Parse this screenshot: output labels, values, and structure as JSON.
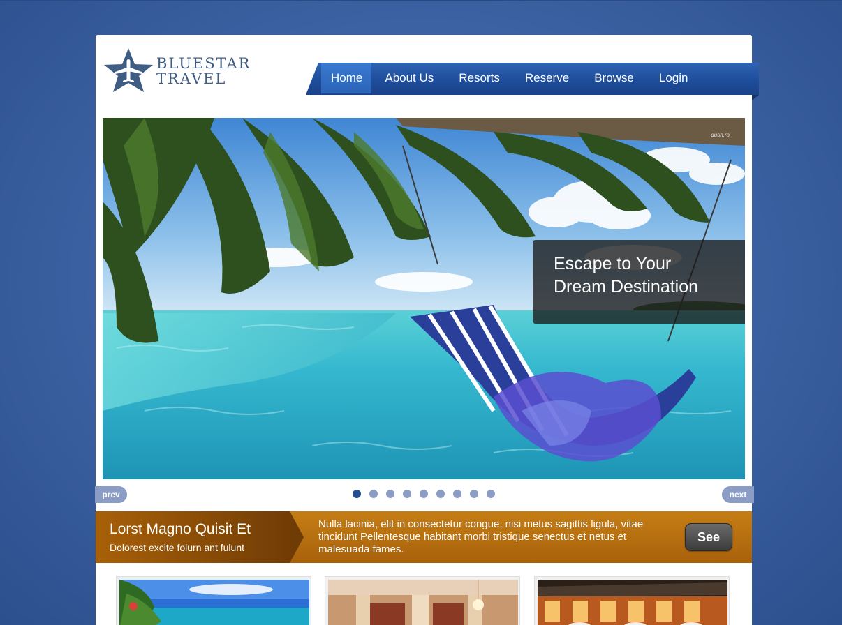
{
  "logo": {
    "line1": "BlueStar",
    "line2": "Travel",
    "icon": "star-airplane-icon"
  },
  "nav": {
    "items": [
      {
        "label": "Home",
        "active": true
      },
      {
        "label": "About Us"
      },
      {
        "label": "Resorts"
      },
      {
        "label": "Reserve"
      },
      {
        "label": "Browse"
      },
      {
        "label": "Login"
      }
    ]
  },
  "slider": {
    "caption_line1": "Escape to Your",
    "caption_line2": "Dream Destination",
    "watermark": "dush.ro",
    "prev_label": "prev",
    "next_label": "next",
    "slide_count": 9,
    "active_slide": 1
  },
  "promo": {
    "title": "Lorst Magno Quisit Et",
    "subtitle": "Dolorest excite folurn ant fulunt",
    "text": "Nulla lacinia, elit in consectetur congue, nisi metus sagittis ligula, vitae tincidunt Pellentesque habitant morbi tristique senectus et netus et malesuada fames.",
    "button_label": "See"
  },
  "thumbnails": [
    {
      "subject": "tropical beach"
    },
    {
      "subject": "hotel lobby"
    },
    {
      "subject": "resort restaurant at night"
    }
  ],
  "colors": {
    "background": "#3f65a6",
    "nav": "#1e4d9a",
    "nav_active": "#3a7ad0",
    "promo": "#b8700f",
    "dot": "#8b9dc5",
    "dot_active": "#244e92",
    "logo_text": "#3f5c83"
  }
}
